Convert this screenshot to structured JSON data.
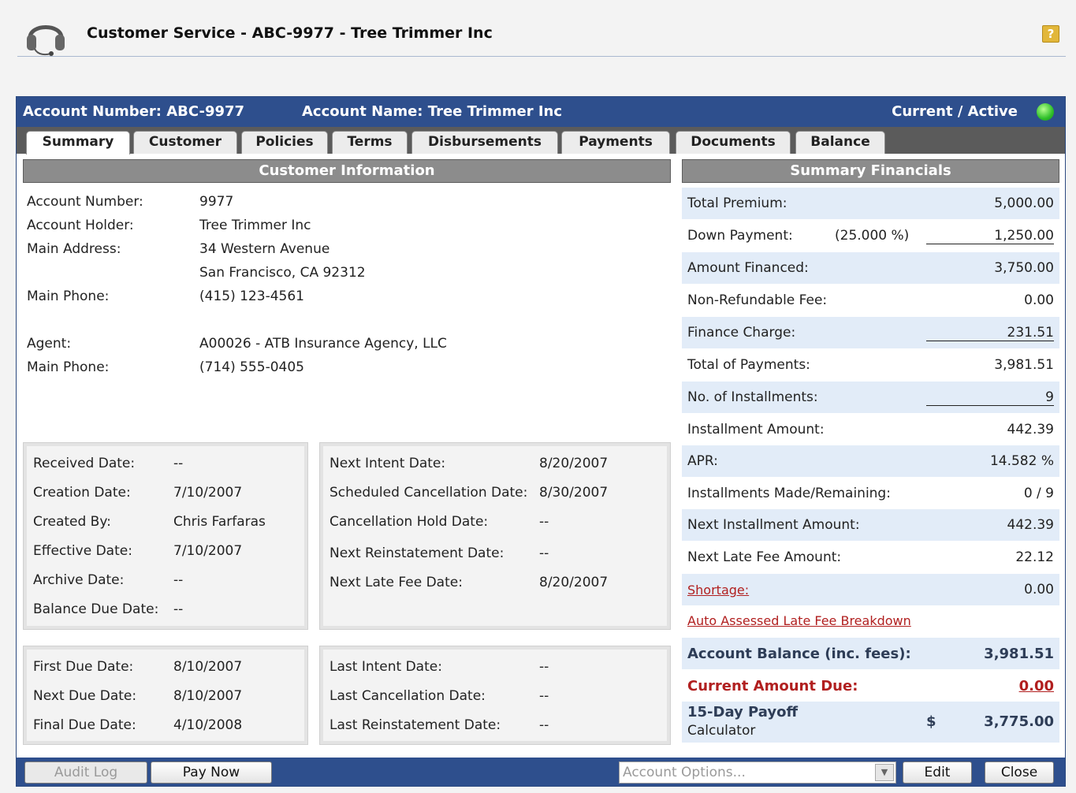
{
  "header": {
    "title": "Customer Service - ABC-9977 - Tree Trimmer Inc",
    "help_label": "?"
  },
  "account_bar": {
    "account_number": "Account Number: ABC-9977",
    "account_name": "Account Name:  Tree Trimmer Inc",
    "status": "Current / Active",
    "status_color": "#2fbf2a"
  },
  "tabs": [
    "Summary",
    "Customer",
    "Policies",
    "Terms",
    "Disbursements",
    "Payments",
    "Documents",
    "Balance"
  ],
  "customer_info": {
    "heading": "Customer Information",
    "rows": [
      {
        "label": "Account Number:",
        "value": "9977"
      },
      {
        "label": "Account Holder:",
        "value": "Tree Trimmer Inc"
      },
      {
        "label": "Main Address:",
        "value": "34 Western Avenue"
      },
      {
        "label": "",
        "value": "San Francisco, CA 92312"
      },
      {
        "label": "Main Phone:",
        "value": "(415) 123-4561"
      },
      {
        "label": "Agent:",
        "value": "A00026 - ATB Insurance Agency, LLC"
      },
      {
        "label": "Main Phone:",
        "value": "(714) 555-0405"
      }
    ]
  },
  "dates_left": [
    {
      "label": "Received Date:",
      "value": "--"
    },
    {
      "label": "Creation Date:",
      "value": "7/10/2007"
    },
    {
      "label": "Created By:",
      "value": "Chris Farfaras"
    },
    {
      "label": "Effective Date:",
      "value": "7/10/2007"
    },
    {
      "label": "Archive Date:",
      "value": "--"
    },
    {
      "label": "Balance Due Date:",
      "value": "--"
    }
  ],
  "dates_right": [
    {
      "label": "Next Intent Date:",
      "value": "8/20/2007"
    },
    {
      "label": "Scheduled Cancellation Date:",
      "value": "8/30/2007"
    },
    {
      "label": "Cancellation Hold Date:",
      "value": "--"
    },
    {
      "label": "Next Reinstatement Date:",
      "value": "--"
    },
    {
      "label": "Next Late Fee Date:",
      "value": "8/20/2007"
    }
  ],
  "due_left": [
    {
      "label": "First Due Date:",
      "value": "8/10/2007"
    },
    {
      "label": "Next Due Date:",
      "value": "8/10/2007"
    },
    {
      "label": "Final Due Date:",
      "value": "4/10/2008"
    }
  ],
  "due_right": [
    {
      "label": "Last Intent Date:",
      "value": "--"
    },
    {
      "label": "Last Cancellation Date:",
      "value": "--"
    },
    {
      "label": "Last Reinstatement Date:",
      "value": "--"
    }
  ],
  "financials": {
    "heading": "Summary Financials",
    "total_premium": {
      "label": "Total Premium:",
      "value": "5,000.00"
    },
    "down_payment": {
      "label": "Down Payment:",
      "pct": "(25.000 %)",
      "value": "1,250.00"
    },
    "amount_financed": {
      "label": "Amount Financed:",
      "value": "3,750.00"
    },
    "non_refundable_fee": {
      "label": "Non-Refundable Fee:",
      "value": "0.00"
    },
    "finance_charge": {
      "label": "Finance Charge:",
      "value": "231.51"
    },
    "total_payments": {
      "label": "Total of Payments:",
      "value": "3,981.51"
    },
    "installments": {
      "label": "No. of Installments:",
      "value": "9"
    },
    "installment_amount": {
      "label": "Installment Amount:",
      "value": "442.39"
    },
    "apr": {
      "label": "APR:",
      "value": "14.582 %"
    },
    "made_remaining": {
      "label": "Installments Made/Remaining:",
      "value": "0 / 9"
    },
    "next_installment": {
      "label": "Next Installment Amount:",
      "value": "442.39"
    },
    "next_late_fee": {
      "label": "Next Late Fee Amount:",
      "value": "22.12"
    },
    "shortage": {
      "label": "Shortage:",
      "value": "0.00"
    },
    "auto_assessed_link": "Auto Assessed Late Fee Breakdown",
    "account_balance": {
      "label": "Account Balance (inc. fees):",
      "value": "3,981.51"
    },
    "current_due": {
      "label": "Current Amount Due:",
      "value": "0.00"
    },
    "payoff": {
      "label": "15-Day Payoff",
      "sub": "Calculator",
      "currency": "$",
      "value": "3,775.00"
    }
  },
  "footer": {
    "audit_log": "Audit Log",
    "pay_now": "Pay Now",
    "account_options_placeholder": "Account Options...",
    "edit": "Edit",
    "close": "Close"
  }
}
